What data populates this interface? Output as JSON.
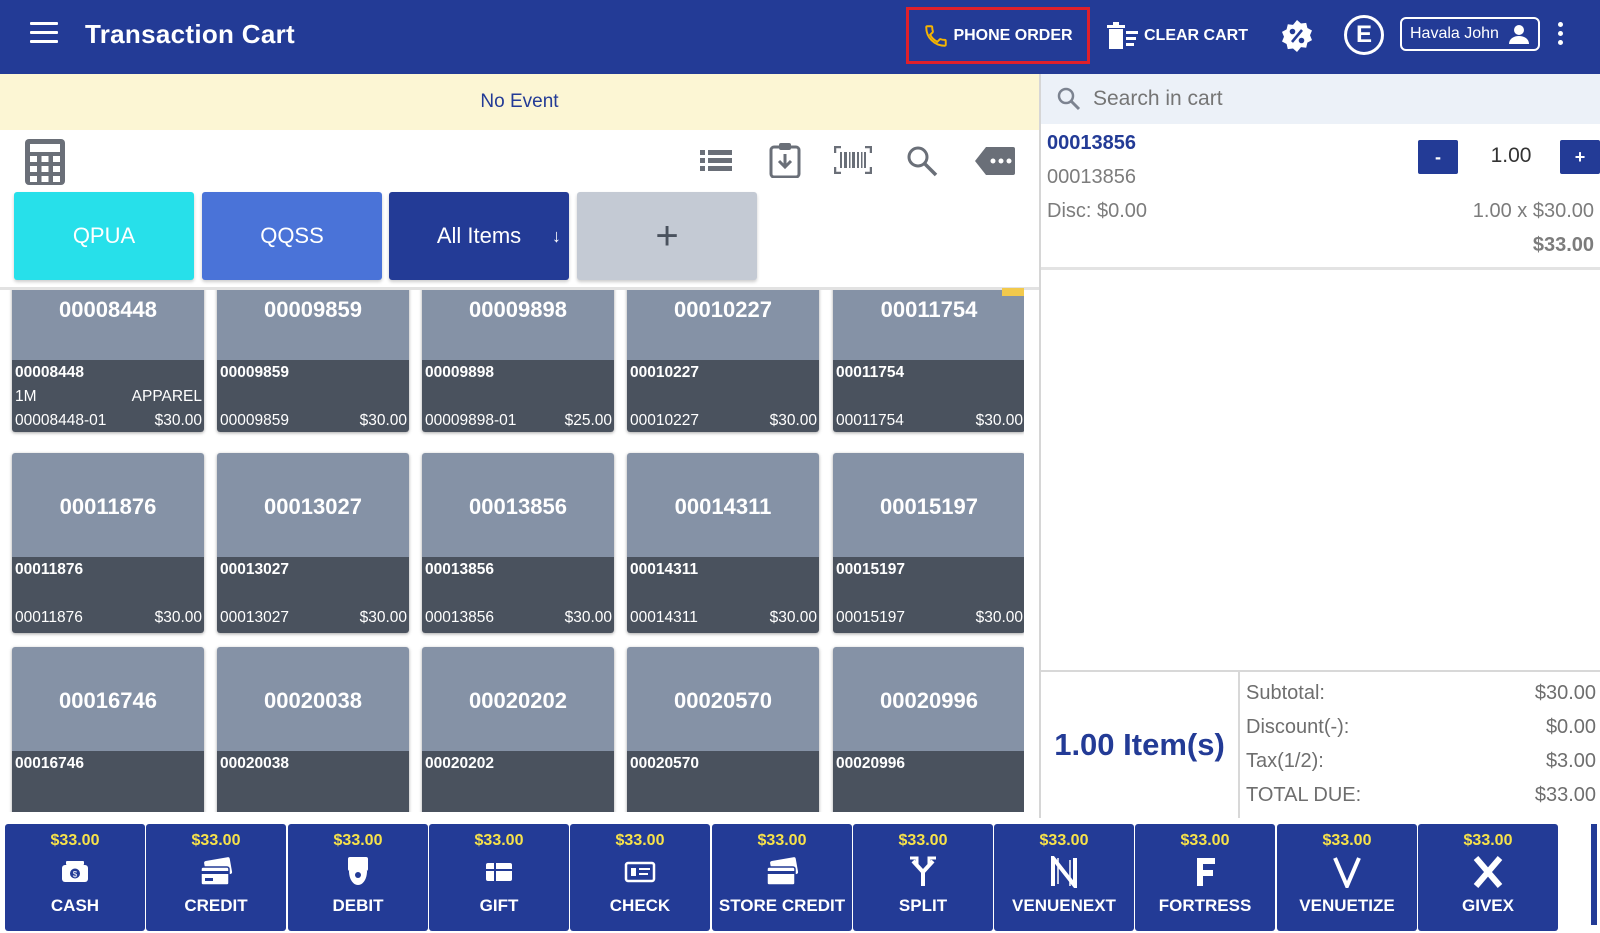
{
  "header": {
    "title": "Transaction Cart",
    "phone_order": "PHONE ORDER",
    "clear_cart": "CLEAR CART",
    "badge_letter": "E",
    "user_name": "Havala John"
  },
  "event_bar": {
    "text": "No Event"
  },
  "categories": [
    {
      "label": "QPUA",
      "color": "#27e0ea"
    },
    {
      "label": "QQSS",
      "color": "#4a73d8"
    },
    {
      "label": "All Items",
      "color": "#233b96"
    },
    {
      "label": "+",
      "color": "#c4cad4"
    }
  ],
  "tiles": [
    {
      "title": "00008448",
      "code": "00008448",
      "mid_left": "1M",
      "mid_right": "APPAREL",
      "sku": "00008448-01",
      "price": "$30.00"
    },
    {
      "title": "00009859",
      "code": "00009859",
      "mid_left": "",
      "mid_right": "",
      "sku": "00009859",
      "price": "$30.00"
    },
    {
      "title": "00009898",
      "code": "00009898",
      "mid_left": "",
      "mid_right": "",
      "sku": "00009898-01",
      "price": "$25.00"
    },
    {
      "title": "00010227",
      "code": "00010227",
      "mid_left": "",
      "mid_right": "",
      "sku": "00010227",
      "price": "$30.00"
    },
    {
      "title": "00011754",
      "code": "00011754",
      "mid_left": "",
      "mid_right": "",
      "sku": "00011754",
      "price": "$30.00"
    },
    {
      "title": "00011876",
      "code": "00011876",
      "mid_left": "",
      "mid_right": "",
      "sku": "00011876",
      "price": "$30.00"
    },
    {
      "title": "00013027",
      "code": "00013027",
      "mid_left": "",
      "mid_right": "",
      "sku": "00013027",
      "price": "$30.00"
    },
    {
      "title": "00013856",
      "code": "00013856",
      "mid_left": "",
      "mid_right": "",
      "sku": "00013856",
      "price": "$30.00"
    },
    {
      "title": "00014311",
      "code": "00014311",
      "mid_left": "",
      "mid_right": "",
      "sku": "00014311",
      "price": "$30.00"
    },
    {
      "title": "00015197",
      "code": "00015197",
      "mid_left": "",
      "mid_right": "",
      "sku": "00015197",
      "price": "$30.00"
    },
    {
      "title": "00016746",
      "code": "00016746",
      "mid_left": "",
      "mid_right": "",
      "sku": "",
      "price": ""
    },
    {
      "title": "00020038",
      "code": "00020038",
      "mid_left": "",
      "mid_right": "",
      "sku": "",
      "price": ""
    },
    {
      "title": "00020202",
      "code": "00020202",
      "mid_left": "",
      "mid_right": "",
      "sku": "",
      "price": ""
    },
    {
      "title": "00020570",
      "code": "00020570",
      "mid_left": "",
      "mid_right": "",
      "sku": "",
      "price": ""
    },
    {
      "title": "00020996",
      "code": "00020996",
      "mid_left": "",
      "mid_right": "",
      "sku": "",
      "price": ""
    }
  ],
  "cart": {
    "search_placeholder": "Search in cart",
    "item": {
      "id": "00013856",
      "sub": "00013856",
      "disc": "Disc: $0.00",
      "qty": "1.00",
      "unit": "1.00 x $30.00",
      "total": "$33.00",
      "minus": "-",
      "plus": "+"
    }
  },
  "totals": {
    "item_count": "1.00 Item(s)",
    "rows": [
      {
        "label": "Subtotal:",
        "value": "$30.00"
      },
      {
        "label": "Discount(-):",
        "value": "$0.00"
      },
      {
        "label": "Tax(1/2):",
        "value": "$3.00"
      },
      {
        "label": "TOTAL DUE:",
        "value": "$33.00"
      }
    ]
  },
  "payments": [
    {
      "amount": "$33.00",
      "label": "CASH",
      "icon": "cash-icon"
    },
    {
      "amount": "$33.00",
      "label": "CREDIT",
      "icon": "credit-card-icon"
    },
    {
      "amount": "$33.00",
      "label": "DEBIT",
      "icon": "debit-icon"
    },
    {
      "amount": "$33.00",
      "label": "GIFT",
      "icon": "gift-card-icon"
    },
    {
      "amount": "$33.00",
      "label": "CHECK",
      "icon": "check-icon"
    },
    {
      "amount": "$33.00",
      "label": "STORE CREDIT",
      "icon": "store-credit-icon"
    },
    {
      "amount": "$33.00",
      "label": "SPLIT",
      "icon": "split-icon"
    },
    {
      "amount": "$33.00",
      "label": "VENUENEXT",
      "icon": "venuenext-icon"
    },
    {
      "amount": "$33.00",
      "label": "FORTRESS",
      "icon": "fortress-icon"
    },
    {
      "amount": "$33.00",
      "label": "VENUETIZE",
      "icon": "venuetize-icon"
    },
    {
      "amount": "$33.00",
      "label": "GIVEX",
      "icon": "givex-icon"
    }
  ],
  "colors": {
    "primary": "#233b96",
    "event_bg": "#fcf6d4",
    "pay_amount": "#f7e24a",
    "highlight": "#e0202a"
  }
}
